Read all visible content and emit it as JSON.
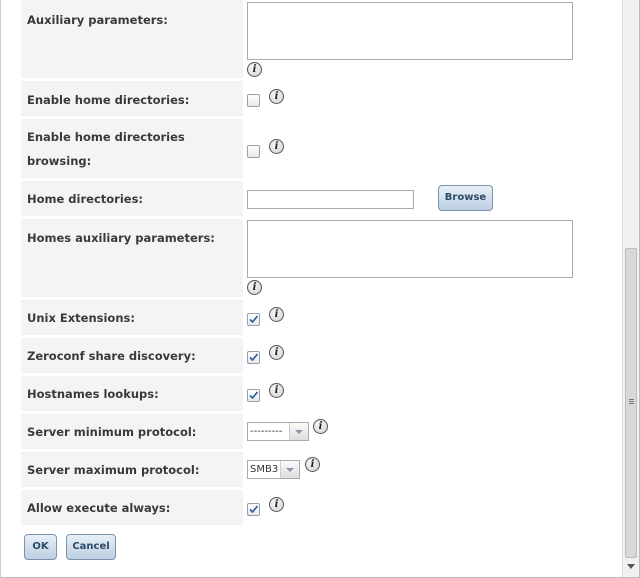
{
  "form": {
    "auxiliary_parameters": {
      "label": "Auxiliary parameters:"
    },
    "enable_home_directories": {
      "label": "Enable home directories:",
      "checked": false
    },
    "enable_home_directories_browsing": {
      "label_line1": "Enable home directories",
      "label_line2": "browsing:",
      "checked": false
    },
    "home_directories": {
      "label": "Home directories:",
      "value": "",
      "browse_label": "Browse"
    },
    "homes_auxiliary_parameters": {
      "label": "Homes auxiliary parameters:"
    },
    "unix_extensions": {
      "label": "Unix Extensions:",
      "checked": true
    },
    "zeroconf_share_discovery": {
      "label": "Zeroconf share discovery:",
      "checked": true
    },
    "hostnames_lookups": {
      "label": "Hostnames lookups:",
      "checked": true
    },
    "server_minimum_protocol": {
      "label": "Server minimum protocol:",
      "value": "---------"
    },
    "server_maximum_protocol": {
      "label": "Server maximum protocol:",
      "value": "SMB3"
    },
    "allow_execute_always": {
      "label": "Allow execute always:",
      "checked": true
    }
  },
  "buttons": {
    "ok": "OK",
    "cancel": "Cancel"
  },
  "info_glyph": "i",
  "icons": {
    "help": "info-icon",
    "check": "checkmark-icon"
  },
  "colors": {
    "label_bg": "#f4f4f4",
    "button_border": "#7b93ad",
    "check": "#2a5a9a"
  }
}
